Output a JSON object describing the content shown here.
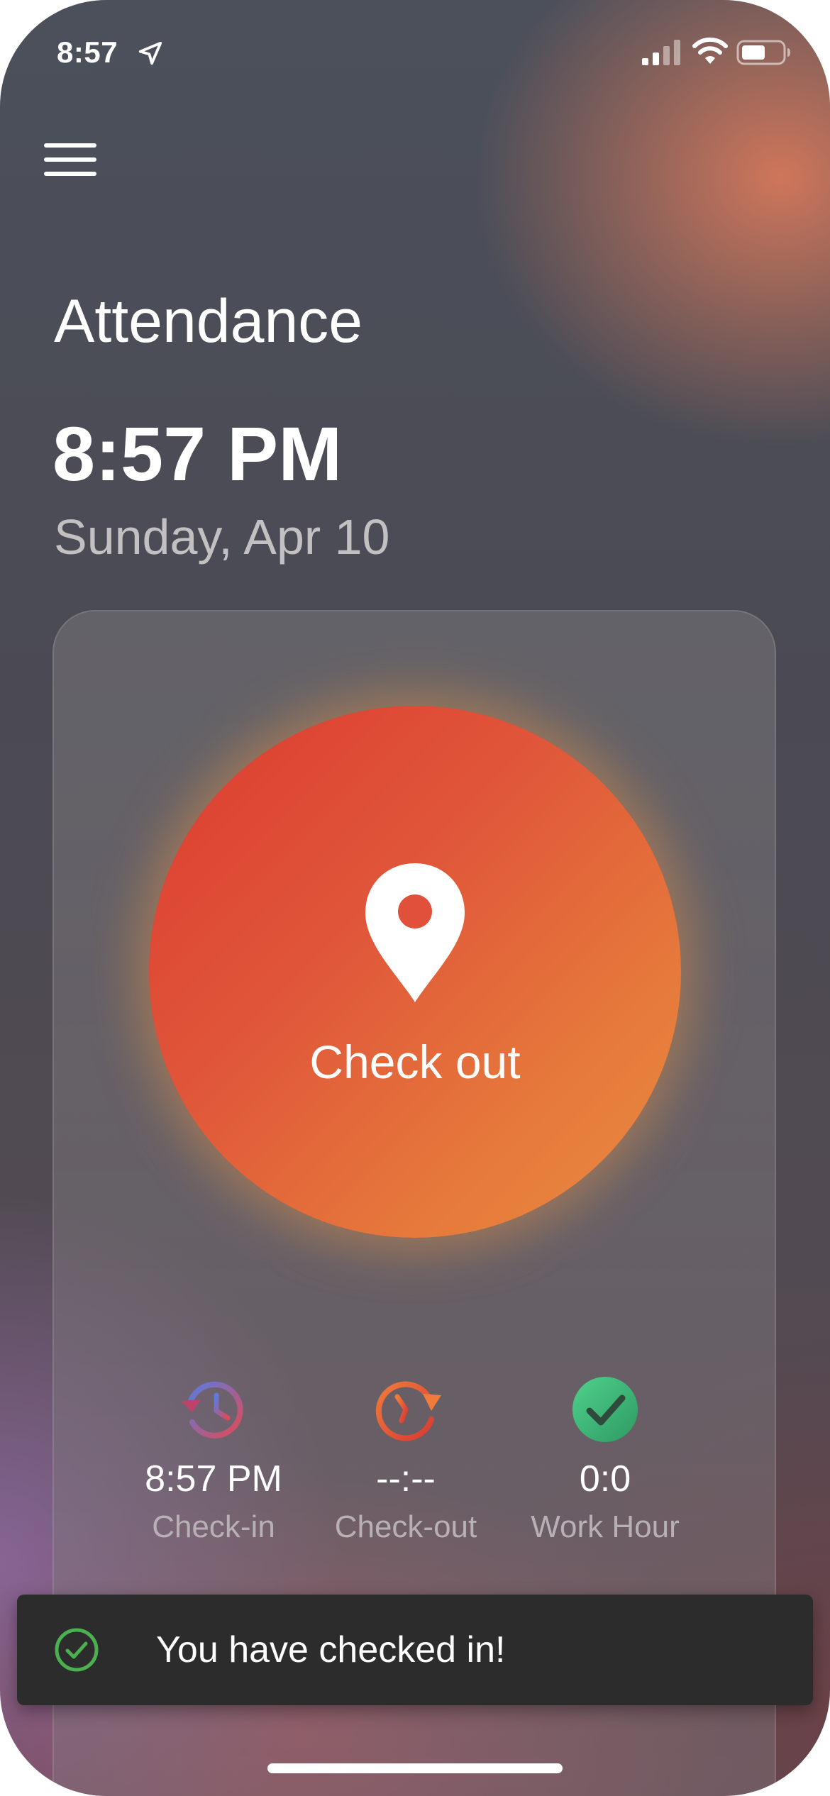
{
  "status_bar": {
    "time": "8:57",
    "location_icon": "location-arrow-icon",
    "signal_icon": "cellular-signal-icon",
    "wifi_icon": "wifi-icon",
    "battery_icon": "battery-icon"
  },
  "header": {
    "menu_icon": "hamburger-menu-icon",
    "title": "Attendance",
    "current_time": "8:57 PM",
    "current_date": "Sunday, Apr 10"
  },
  "check_button": {
    "icon": "map-pin-icon",
    "label": "Check out",
    "colors": {
      "start": "#dc3b30",
      "end": "#e98c40"
    }
  },
  "stats": [
    {
      "icon": "history-clock-icon",
      "value": "8:57 PM",
      "label": "Check-in"
    },
    {
      "icon": "clock-refresh-icon",
      "value": "--:--",
      "label": "Check-out"
    },
    {
      "icon": "check-circle-icon",
      "value": "0:0",
      "label": "Work Hour"
    }
  ],
  "toast": {
    "icon": "check-circle-outline-icon",
    "message": "You have checked in!",
    "accent_color": "#4caf50"
  }
}
